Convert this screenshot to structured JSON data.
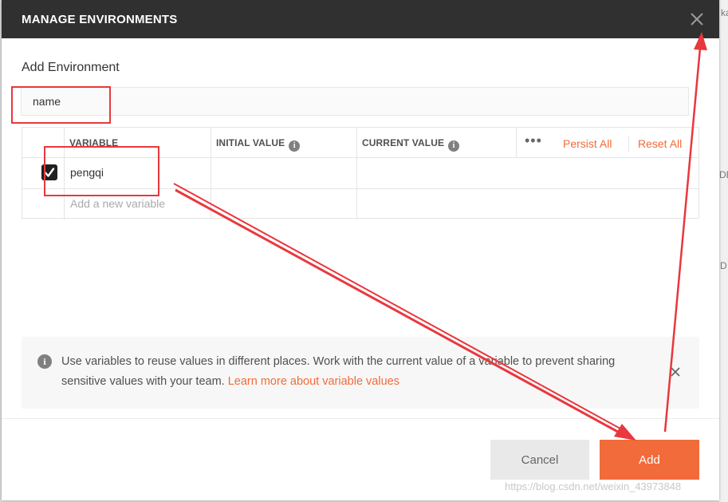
{
  "dialog": {
    "title": "MANAGE ENVIRONMENTS",
    "subtitle": "Add Environment",
    "name_value": "name"
  },
  "table": {
    "headers": {
      "variable": "VARIABLE",
      "initial_value": "INITIAL VALUE",
      "current_value": "CURRENT VALUE"
    },
    "more_icon": "more-dots-icon",
    "persist_all": "Persist All",
    "reset_all": "Reset All",
    "rows": [
      {
        "enabled": true,
        "variable": "pengqi",
        "initial_value": "",
        "current_value": ""
      }
    ],
    "add_placeholder": "Add a new variable"
  },
  "info": {
    "text": "Use variables to reuse values in different places. Work with the current value of a variable to prevent sharing sensitive values with your team.",
    "link": "Learn more about variable values"
  },
  "buttons": {
    "cancel": "Cancel",
    "add": "Add"
  },
  "watermark": "https://blog.csdn.net/weixin_43973848",
  "background_fragments": [
    "ka",
    "DE",
    "D"
  ],
  "colors": {
    "accent": "#f26b3a",
    "header_bg": "#303030",
    "annotation_red": "#e8383d"
  }
}
